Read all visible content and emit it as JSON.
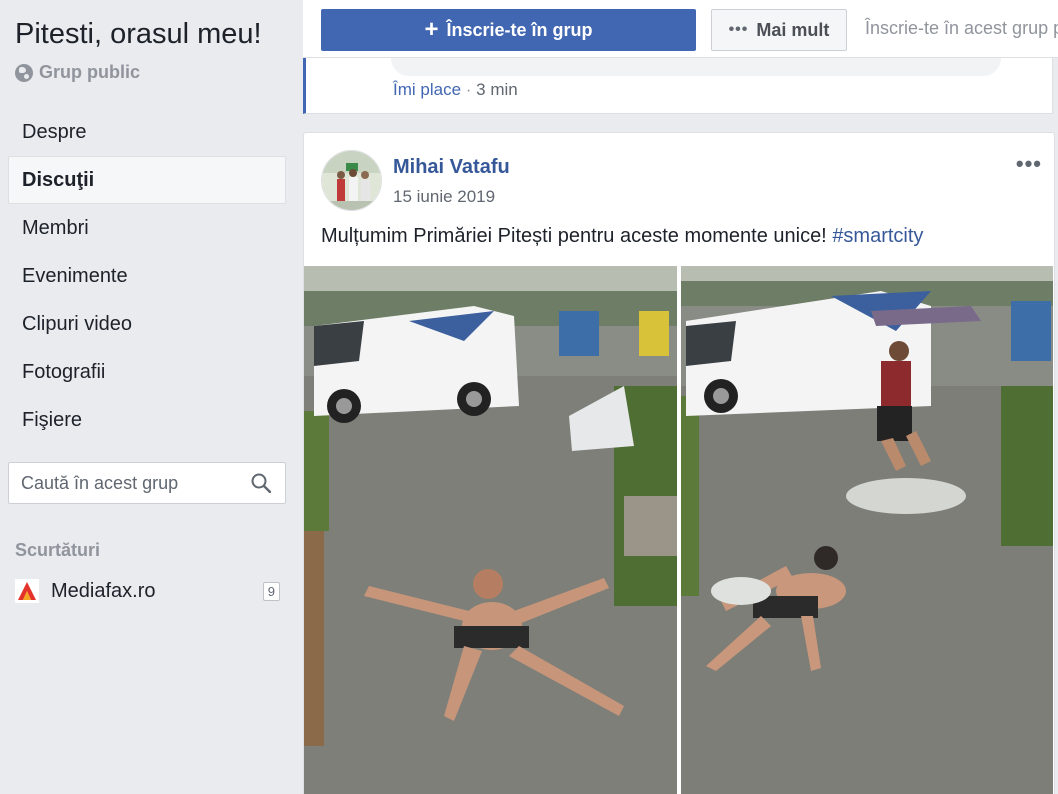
{
  "sidebar": {
    "group_title": "Pitesti, orasul meu!",
    "group_type": "Grup public",
    "nav": [
      "Despre",
      "Discuţii",
      "Membri",
      "Evenimente",
      "Clipuri video",
      "Fotografii",
      "Fişiere"
    ],
    "active_nav": "Discuţii",
    "search_placeholder": "Caută în acest grup",
    "shortcuts_title": "Scurtături",
    "shortcut": {
      "label": "Mediafax.ro",
      "count": "9"
    }
  },
  "topbar": {
    "join_label": "Înscrie-te în grup",
    "more_label": "Mai mult",
    "hint": "Înscrie-te în acest grup p"
  },
  "previous_post": {
    "like": "Îmi place",
    "separator": "·",
    "time": "3 min"
  },
  "post": {
    "author": "Mihai Vatafu",
    "date": "15 iunie 2019",
    "text": "Mulțumim Primăriei Pitești pentru aceste momente unice!",
    "hashtag": "#smartcity"
  },
  "colors": {
    "brand": "#4267b2",
    "link": "#365899",
    "background": "#e9ebee"
  }
}
